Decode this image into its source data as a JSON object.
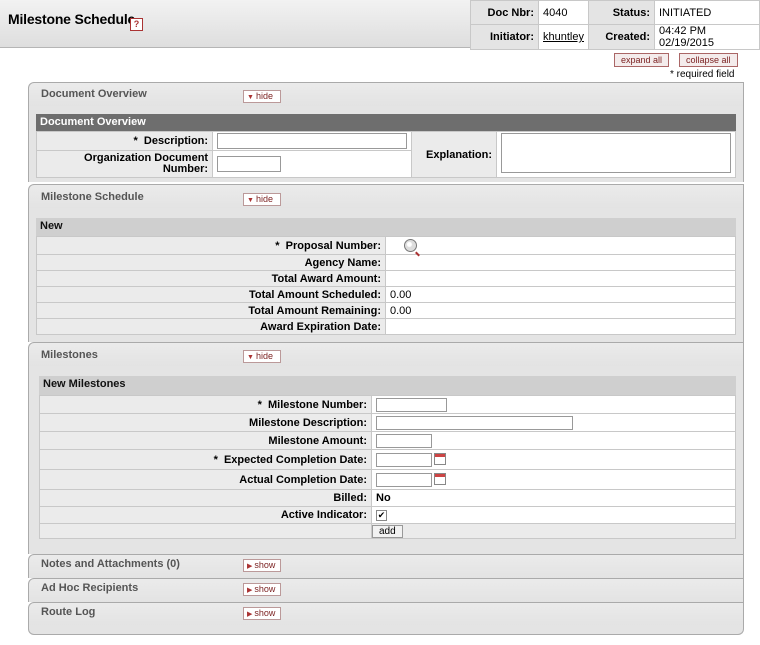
{
  "header": {
    "title": "Milestone Schedule",
    "help_label": "?",
    "doc_nbr_label": "Doc Nbr:",
    "doc_nbr": "4040",
    "status_label": "Status:",
    "status": "INITIATED",
    "initiator_label": "Initiator:",
    "initiator": "khuntley",
    "created_label": "Created:",
    "created": "04:42 PM 02/19/2015"
  },
  "controls": {
    "expand_all": "expand all",
    "collapse_all": "collapse all",
    "required_note": "* required field"
  },
  "tabs": {
    "document_overview": {
      "label": "Document Overview",
      "button": "hide"
    },
    "milestone_schedule": {
      "label": "Milestone Schedule",
      "button": "hide"
    },
    "milestones": {
      "label": "Milestones",
      "button": "hide"
    },
    "notes": {
      "label": "Notes and Attachments (0)",
      "button": "show"
    },
    "adhoc": {
      "label": "Ad Hoc Recipients",
      "button": "show"
    },
    "route_log": {
      "label": "Route Log",
      "button": "show"
    }
  },
  "document_overview": {
    "section_title": "Document Overview",
    "description_label": "Description:",
    "description_value": "",
    "org_doc_number_label_1": "Organization Document",
    "org_doc_number_label_2": "Number:",
    "org_doc_number_value": "",
    "explanation_label": "Explanation:",
    "explanation_value": ""
  },
  "milestone_schedule": {
    "section_title": "New",
    "rows": [
      {
        "label": "Proposal Number:",
        "required": true,
        "value": ""
      },
      {
        "label": "Agency Name:",
        "value": ""
      },
      {
        "label": "Total Award Amount:",
        "value": ""
      },
      {
        "label": "Total Amount Scheduled:",
        "value": "0.00"
      },
      {
        "label": "Total Amount Remaining:",
        "value": "0.00"
      },
      {
        "label": "Award Expiration Date:",
        "value": ""
      }
    ]
  },
  "milestones": {
    "section_title": "New Milestones",
    "milestone_number_label": "Milestone Number:",
    "milestone_description_label": "Milestone Description:",
    "milestone_amount_label": "Milestone Amount:",
    "expected_completion_label": "Expected Completion Date:",
    "actual_completion_label": "Actual Completion Date:",
    "billed_label": "Billed:",
    "billed_value": "No",
    "active_indicator_label": "Active Indicator:",
    "active_indicator_checked": true,
    "add_button": "add"
  },
  "required_mark": "*",
  "check_mark": "✔",
  "tri_right": "▶",
  "tri_down": "▼"
}
